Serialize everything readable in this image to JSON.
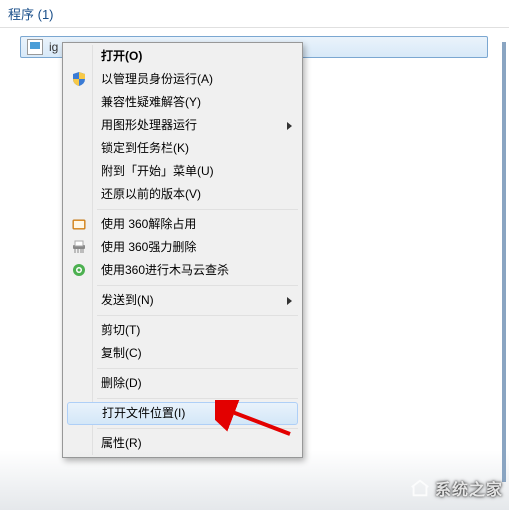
{
  "header": {
    "title": "程序 (1)"
  },
  "file": {
    "name_truncated": "ig"
  },
  "menu": {
    "open": "打开(O)",
    "run_as_admin": "以管理员身份运行(A)",
    "troubleshoot": "兼容性疑难解答(Y)",
    "run_with_gpu": "用图形处理器运行",
    "pin_taskbar": "锁定到任务栏(K)",
    "pin_start": "附到「开始」菜单(U)",
    "restore_versions": "还原以前的版本(V)",
    "unlock_360": "使用 360解除占用",
    "force_delete_360": "使用 360强力删除",
    "scan_360": "使用360进行木马云查杀",
    "send_to": "发送到(N)",
    "cut": "剪切(T)",
    "copy": "复制(C)",
    "delete": "删除(D)",
    "open_location": "打开文件位置(I)",
    "properties": "属性(R)"
  },
  "watermark": {
    "text": "系统之家"
  }
}
